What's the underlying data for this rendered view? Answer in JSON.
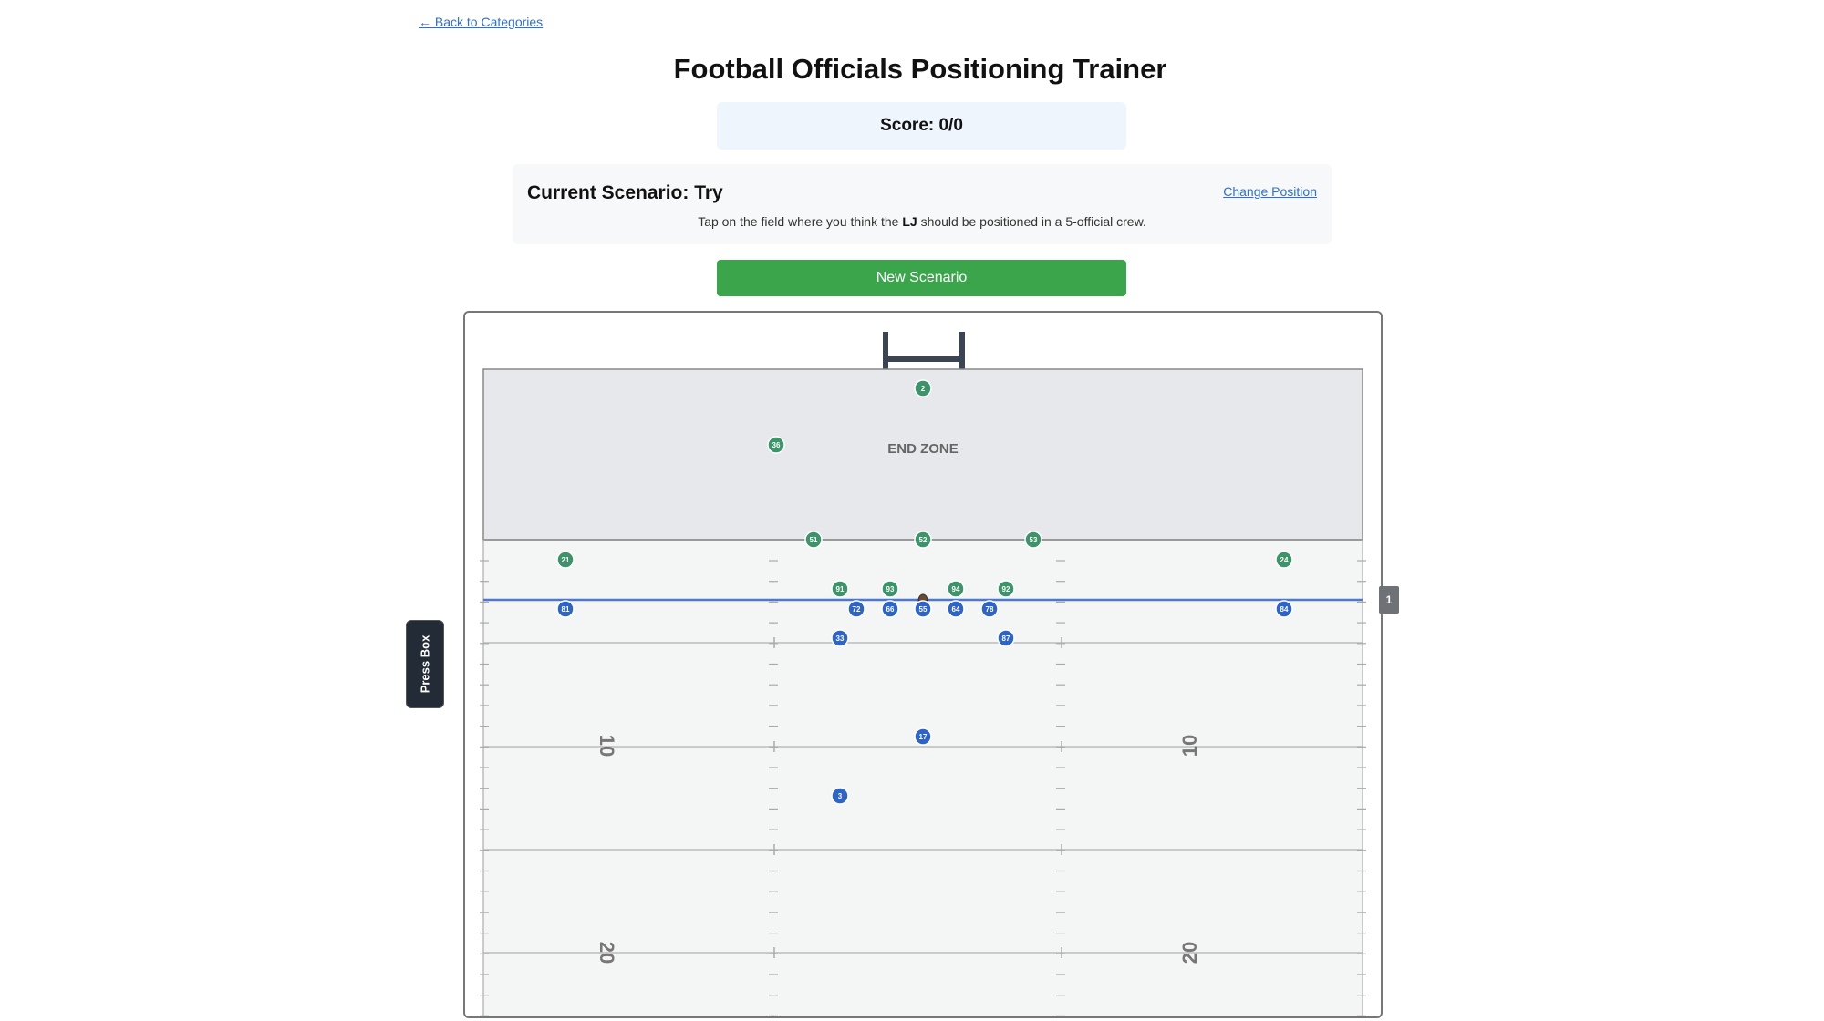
{
  "nav": {
    "back_label": "← Back to Categories"
  },
  "title": "Football Officials Positioning Trainer",
  "score": "Score: 0/0",
  "scenario": {
    "title": "Current Scenario: Try",
    "change_label": "Change Position",
    "instruction_prefix": "Tap on the field where you think the ",
    "position": "LJ",
    "instruction_suffix": " should be positioned in a 5-official crew."
  },
  "new_scenario_label": "New Scenario",
  "field": {
    "end_zone_label": "END ZONE",
    "press_box_label": "Press Box",
    "down_marker": "1",
    "yard_numbers": [
      "10",
      "10",
      "20",
      "20"
    ],
    "colors": {
      "defense": "#3d9468",
      "offense": "#2d64c5",
      "scrimmage_line": "#4a78d6",
      "end_zone": "#e6e8ec",
      "turf": "#f4f5f5",
      "goalpost": "#3a4452"
    },
    "defense_players": [
      "2",
      "36",
      "51",
      "52",
      "53",
      "21",
      "24",
      "91",
      "93",
      "94",
      "92"
    ],
    "offense_players": [
      "81",
      "72",
      "66",
      "55",
      "64",
      "78",
      "84",
      "33",
      "87",
      "17",
      "3"
    ]
  }
}
